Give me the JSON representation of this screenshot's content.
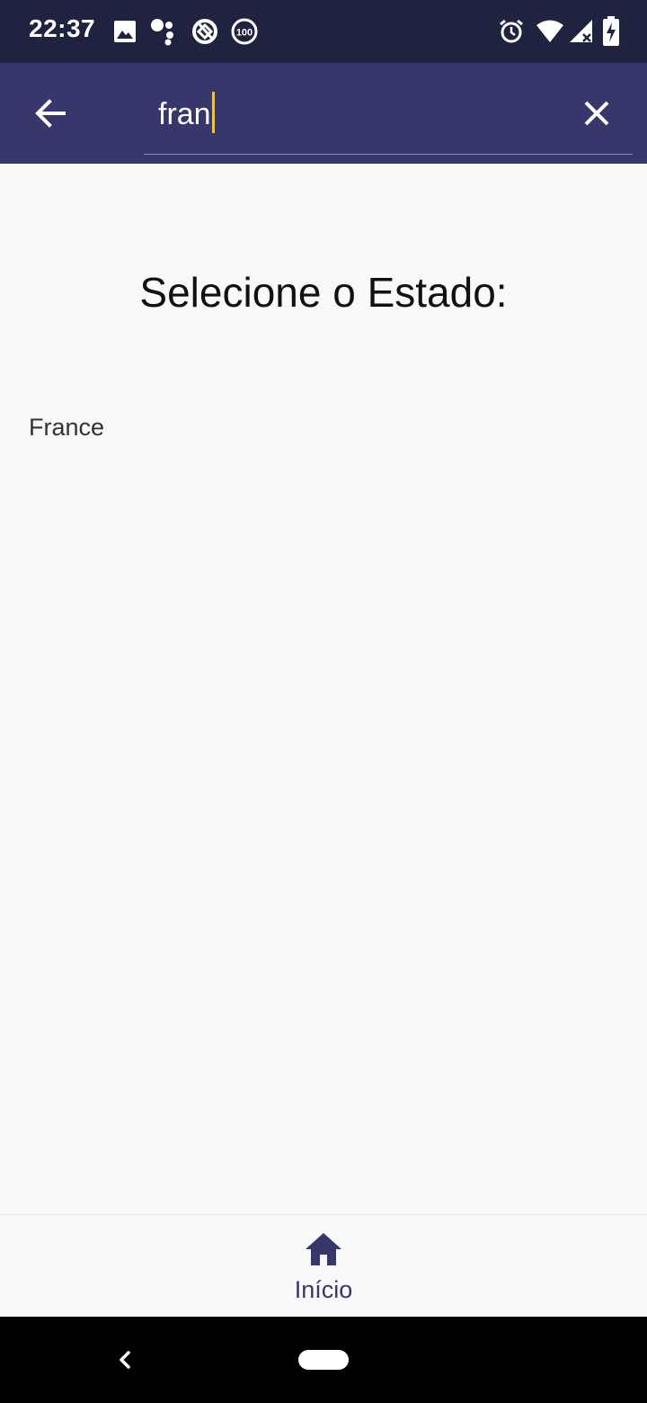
{
  "status_bar": {
    "time": "22:37",
    "background": "#202340",
    "left_icons": [
      "image-icon",
      "assistant-dots-icon",
      "data-saver-icon",
      "battery-100-badge-icon"
    ],
    "right_icons": [
      "alarm-icon",
      "wifi-icon",
      "cellular-signal-no-data-icon",
      "battery-charging-icon"
    ]
  },
  "app_bar": {
    "background": "#37376b",
    "back_icon": "arrow-left-icon",
    "search_value": "fran",
    "clear_icon": "close-icon",
    "caret_color": "#e7c24d"
  },
  "main": {
    "title": "Selecione o Estado:",
    "results": [
      {
        "label": "France"
      }
    ]
  },
  "bottom_nav": {
    "items": [
      {
        "label": "Início",
        "icon": "home-icon",
        "selected": true
      }
    ],
    "accent": "#37376b"
  },
  "system_nav": {
    "back_icon": "chevron-left-icon",
    "home_icon": "home-pill-icon"
  }
}
